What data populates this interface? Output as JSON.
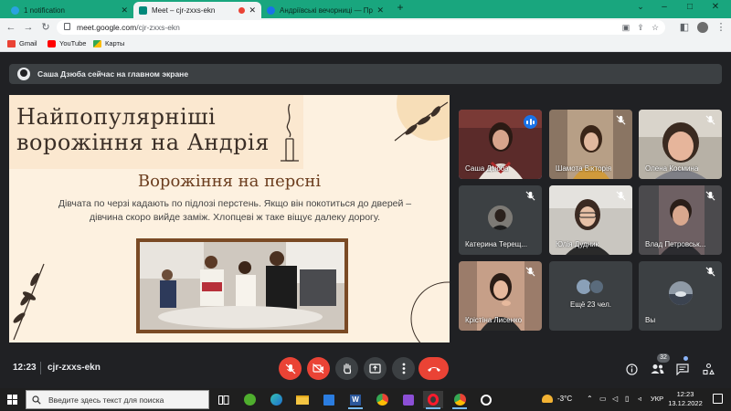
{
  "browser": {
    "tabs": [
      {
        "title": "1 notification",
        "active": false,
        "favicon_color": "#2aa3e0"
      },
      {
        "title": "Meet – cjr-zxxs-ekn",
        "active": true,
        "favicon_color": "#00897b"
      },
      {
        "title": "Андріївські вечорниці — През",
        "active": false,
        "favicon_color": "#1a73e8"
      }
    ],
    "new_tab_label": "+",
    "window_controls": {
      "minimize": "–",
      "maximize": "□",
      "close": "✕"
    },
    "url_host": "meet.google.com",
    "url_path": "/cjr-zxxs-ekn",
    "bookmarks": [
      {
        "label": "Gmail",
        "color": "#ea4335"
      },
      {
        "label": "YouTube",
        "color": "#ff0000"
      },
      {
        "label": "Карты",
        "color": "#34a853"
      }
    ]
  },
  "meet": {
    "banner_text": "Саша Дзюба сейчас на главном экране",
    "slide": {
      "title": "Найпопулярніші ворожіння на Андрія",
      "subtitle": "Ворожіння на персні",
      "body": "Дівчата по черзі кадають по підлозі перстень. Якщо він покотиться до дверей – дівчина скоро вийде заміж. Хлопцеві ж таке віщує далеку дорогу."
    },
    "participants": [
      {
        "name": "Саша Дзюба",
        "speaking": true
      },
      {
        "name": "Шамота Вікторія",
        "speaking": false
      },
      {
        "name": "Олена Космина",
        "speaking": false
      },
      {
        "name": "Катерина Терещ...",
        "speaking": false
      },
      {
        "name": "Юлія Дудник",
        "speaking": false
      },
      {
        "name": "Влад Петровськ...",
        "speaking": false
      },
      {
        "name": "Крістіна Лисенко",
        "speaking": false
      },
      {
        "name": "Ещё 23 чел.",
        "speaking": false
      },
      {
        "name": "Вы",
        "speaking": false
      }
    ],
    "time": "12:23",
    "meeting_code": "cjr-zxxs-ekn",
    "people_count": "32"
  },
  "taskbar": {
    "search_placeholder": "Введите здесь текст для поиска",
    "weather": "-3°C",
    "language": "УКР",
    "clock_time": "12:23",
    "clock_date": "13.12.2022"
  },
  "colors": {
    "accent_blue": "#1a73e8",
    "mute_red": "#ea4335",
    "tab_strip": "#19a67e"
  }
}
